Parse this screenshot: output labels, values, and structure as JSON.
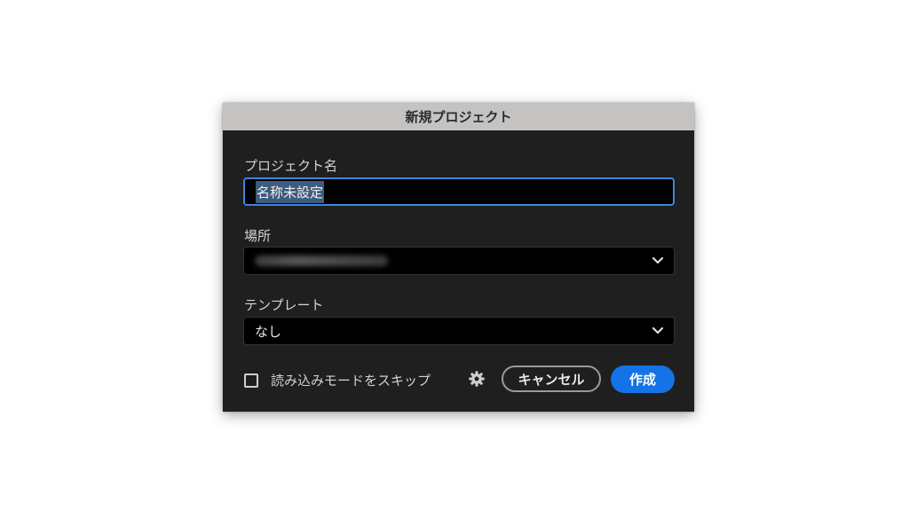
{
  "dialog": {
    "title": "新規プロジェクト"
  },
  "project_name": {
    "label": "プロジェクト名",
    "value": "名称未設定"
  },
  "location": {
    "label": "場所",
    "value_icon": "blurred-path"
  },
  "template": {
    "label": "テンプレート",
    "value": "なし"
  },
  "footer": {
    "skip_import_label": "読み込みモードをスキップ",
    "skip_import_checked": false,
    "settings_icon": "gear-icon",
    "cancel_label": "キャンセル",
    "create_label": "作成"
  },
  "colors": {
    "accent": "#1473e6",
    "focus_border": "#3d86de",
    "titlebar": "#c4c3c1",
    "dialog_bg": "#1f1f1f"
  }
}
